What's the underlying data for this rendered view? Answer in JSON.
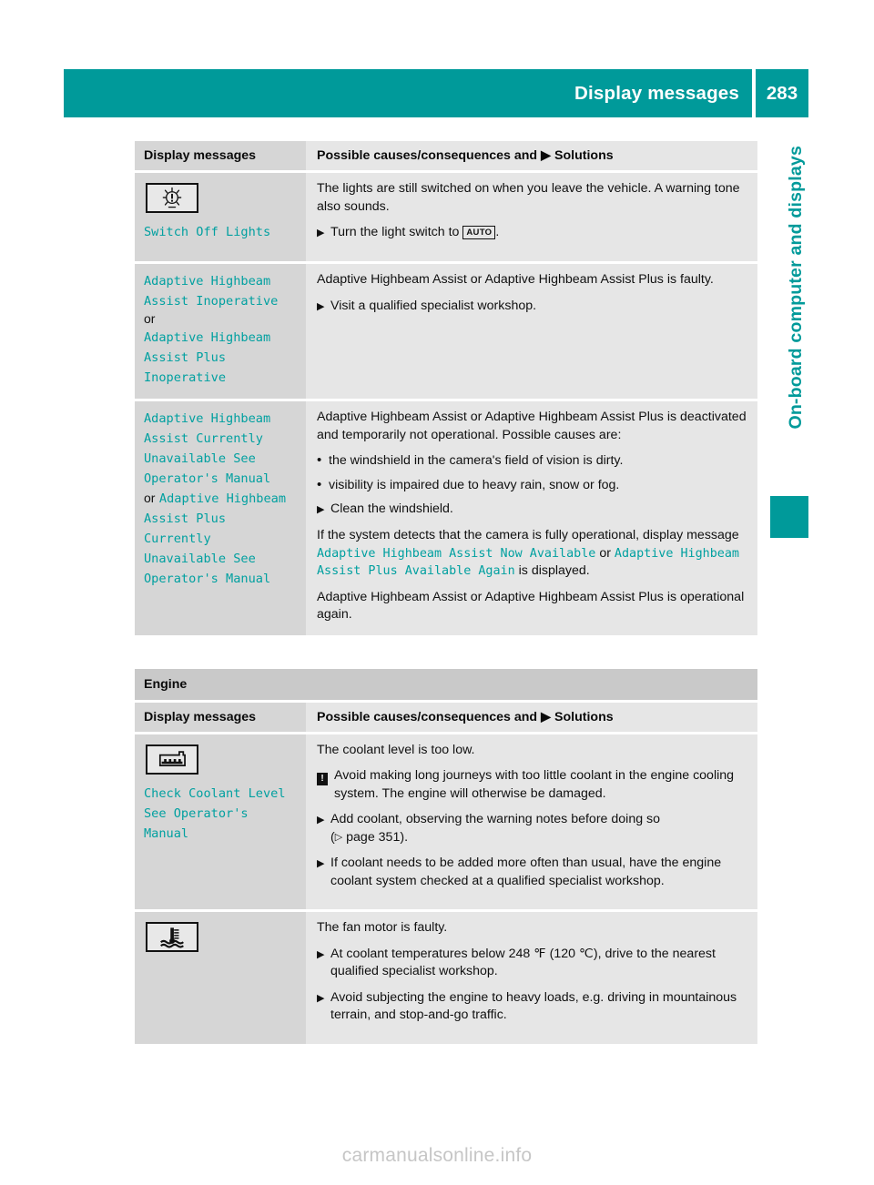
{
  "header": {
    "title": "Display messages",
    "page_number": "283",
    "accent_color": "#009a9a"
  },
  "side_tab": {
    "label": "On-board computer and displays"
  },
  "watermark": {
    "text": "carmanualsonline.info"
  },
  "table_headers": {
    "left": "Display messages",
    "right_prefix": "Possible causes/consequences and",
    "right_arrow": "▶",
    "right_suffix": "Solutions"
  },
  "section_engine": {
    "band_label": "Engine"
  },
  "rows": {
    "switch_off_lights": {
      "icon_name": "lamp-warning-telltale-icon",
      "message": "Switch Off Lights",
      "body_1": "The lights are still switched on when you leave the vehicle. A warning tone also sounds.",
      "step_1_pre": "Turn the light switch to",
      "step_1_key": "AUTO",
      "step_1_post": "."
    },
    "ahb_inoperative": {
      "message_1": "Adaptive Highbeam Assist Inoperative",
      "conjunction": "or",
      "message_2": "Adaptive Highbeam Assist Plus Inoperative",
      "body_1": "Adaptive Highbeam Assist or Adaptive Highbeam Assist Plus is faulty.",
      "step_1": "Visit a qualified specialist workshop."
    },
    "ahb_unavailable": {
      "message_1": "Adaptive Highbeam Assist Currently Unavailable See Operator's Manual",
      "conjunction": "or",
      "message_2": "Adaptive Highbeam Assist Plus Currently Unavailable See Operator's Manual",
      "body_1": "Adaptive Highbeam Assist or Adaptive Highbeam Assist Plus is deactivated and temporarily not operational. Possible causes are:",
      "bullet_1": "the windshield in the camera's field of vision is dirty.",
      "bullet_2": "visibility is impaired due to heavy rain, snow or fog.",
      "step_1": "Clean the windshield.",
      "body_2_pre": "If the system detects that the camera is fully operational, display message",
      "body_2_msg_1": "Adaptive Highbeam Assist Now Available",
      "body_2_or": "or",
      "body_2_msg_2": "Adaptive Highbeam Assist Plus Available Again",
      "body_2_post": "is displayed.",
      "body_3": "Adaptive Highbeam Assist or Adaptive Highbeam Assist Plus is operational again."
    },
    "check_coolant": {
      "icon_name": "coolant-reservoir-telltale-icon",
      "message": "Check Coolant Level See Operator's Manual",
      "body_1": "The coolant level is too low.",
      "note_icon": "!",
      "note_1": "Avoid making long journeys with too little coolant in the engine cooling system. The engine will otherwise be damaged.",
      "step_1": "Add coolant, observing the warning notes before doing so",
      "step_1_ref_open": "(",
      "step_1_ref_arrow": "▷",
      "step_1_ref_text": "page 351",
      "step_1_ref_close": ").",
      "step_2": "If coolant needs to be added more often than usual, have the engine coolant system checked at a qualified specialist workshop."
    },
    "fan_motor": {
      "icon_name": "coolant-temperature-telltale-icon",
      "body_1": "The fan motor is faulty.",
      "step_1": "At coolant temperatures below 248 ℉ (120 ℃), drive to the nearest qualified specialist workshop.",
      "step_2": "Avoid subjecting the engine to heavy loads, e.g. driving in mountainous terrain, and stop-and-go traffic."
    }
  }
}
